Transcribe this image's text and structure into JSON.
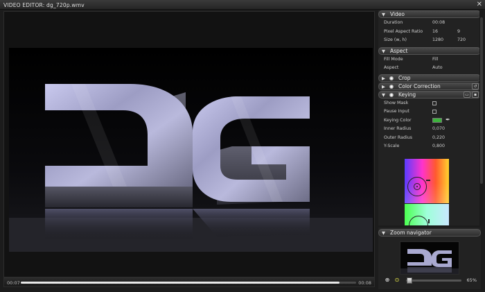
{
  "window": {
    "title": "VIDEO EDITOR: dg_720p.wmv",
    "close_glyph": "✕"
  },
  "viewer": {
    "logo_text": "DG"
  },
  "timeline": {
    "current": "00:07",
    "end": "00:08",
    "progress": 0.95
  },
  "sections": {
    "video": {
      "title": "Video",
      "rows": [
        {
          "label": "Duration",
          "v1": "00:08",
          "v2": ""
        },
        {
          "label": "Pixel Aspect Ratio",
          "v1": "16",
          "v2": "9"
        },
        {
          "label": "Size (w, h)",
          "v1": "1280",
          "v2": "720"
        }
      ]
    },
    "aspect": {
      "title": "Aspect",
      "rows": [
        {
          "label": "Fill Mode",
          "v1": "Fill"
        },
        {
          "label": "Aspect",
          "v1": "Auto"
        }
      ]
    },
    "crop": {
      "title": "Crop"
    },
    "color_correction": {
      "title": "Color Correction"
    },
    "keying": {
      "title": "Keying",
      "show_mask_label": "Show Mask",
      "pause_input_label": "Pause Input",
      "keying_color_label": "Keying Color",
      "keying_color": "#3cb43c",
      "inner_radius_label": "Inner Radius",
      "inner_radius": "0,070",
      "outer_radius_label": "Outer Radius",
      "outer_radius": "0,220",
      "y_scale_label": "Y-Scale",
      "y_scale": "0,800"
    }
  },
  "zoom_navigator": {
    "title": "Zoom navigator",
    "percent": "65%",
    "logo_text": "DG"
  },
  "icons": {
    "arrow_expanded": "▼",
    "arrow_collapsed": "▶",
    "reset": "↺",
    "folder": "▭",
    "save": "▪",
    "eyedropper": "✒",
    "zoom_in": "⊕",
    "zoom_fit": "⊙"
  }
}
